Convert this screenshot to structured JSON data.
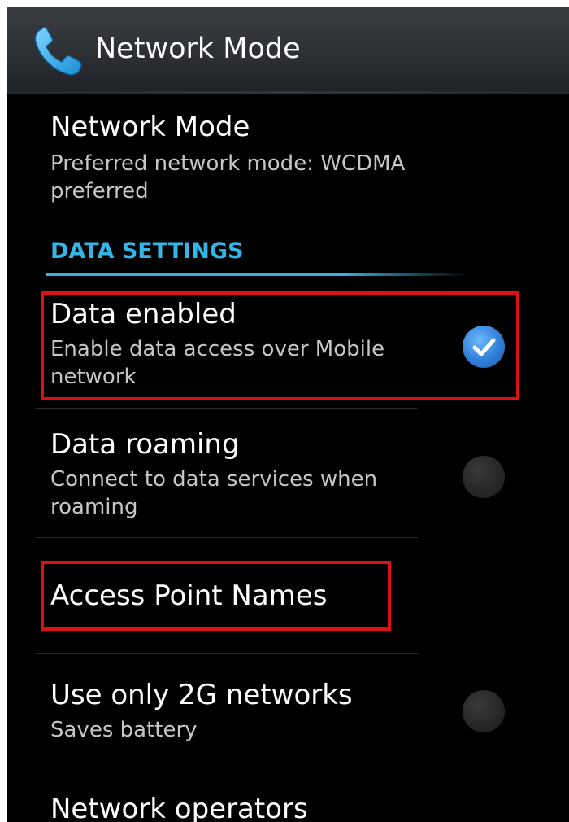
{
  "action_bar": {
    "title": "Network Mode",
    "icon": "phone-icon"
  },
  "preferences": {
    "network_mode": {
      "title": "Network Mode",
      "summary": "Preferred network mode: WCDMA preferred"
    },
    "section_header": "DATA SETTINGS",
    "data_enabled": {
      "title": "Data enabled",
      "summary": "Enable data access over Mobile network",
      "checked": true
    },
    "data_roaming": {
      "title": "Data roaming",
      "summary": "Connect to data services when roaming",
      "checked": false
    },
    "access_point_names": {
      "title": "Access Point Names"
    },
    "use_2g_only": {
      "title": "Use only 2G networks",
      "summary": "Saves battery",
      "checked": false
    },
    "network_operators": {
      "title": "Network operators"
    }
  },
  "colors": {
    "accent": "#33b5e5",
    "highlight": "#e01010",
    "checkbox_on": "#2f7fd8"
  }
}
